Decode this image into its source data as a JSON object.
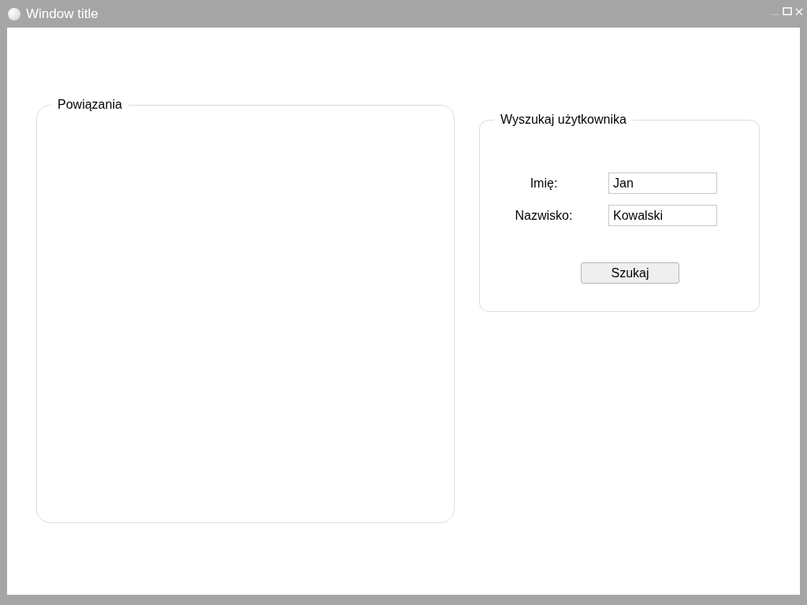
{
  "window": {
    "title": "Window title"
  },
  "links_group": {
    "title": "Powiązania"
  },
  "search_group": {
    "title": "Wyszukaj użytkownika",
    "fields": [
      {
        "label": "Imię:",
        "value": "Jan"
      },
      {
        "label": "Nazwisko:",
        "value": "Kowalski"
      }
    ],
    "button": "Szukaj"
  }
}
